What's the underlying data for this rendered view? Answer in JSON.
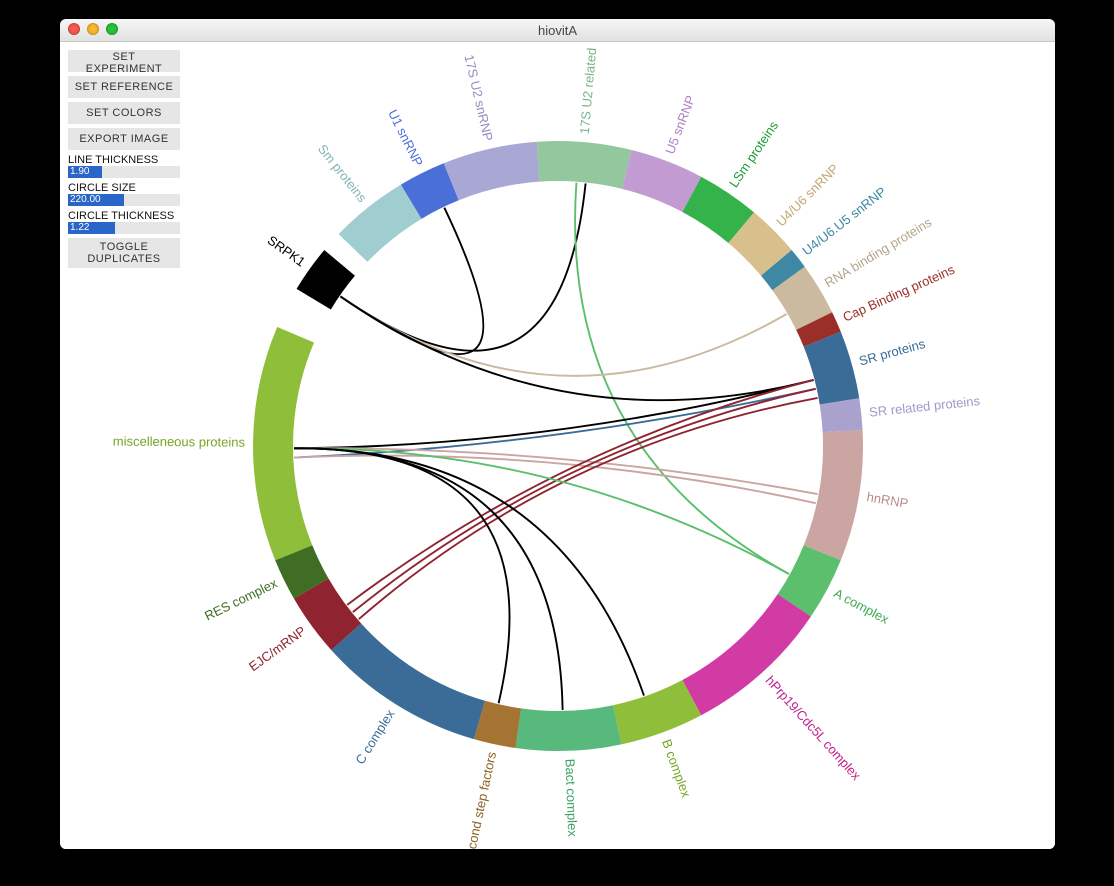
{
  "window": {
    "title": "hiovitA"
  },
  "sidebar": {
    "set_experiment": "SET EXPERIMENT",
    "set_reference": "SET REFERENCE",
    "set_colors": "SET COLORS",
    "export_image": "EXPORT IMAGE",
    "line_thickness_label": "LINE THICKNESS",
    "line_thickness_value": "1.90",
    "circle_size_label": "CIRCLE SIZE",
    "circle_size_value": "220.00",
    "circle_thickness_label": "CIRCLE THICKNESS",
    "circle_thickness_value": "1.22",
    "toggle_duplicates": "TOGGLE\nDUPLICATES"
  },
  "slider_fill": {
    "line_thickness": 0.3,
    "circle_size": 0.5,
    "circle_thickness": 0.42
  },
  "ring": {
    "radius": 305,
    "thickness": 40,
    "segments": [
      {
        "name": "Sm proteins",
        "start": 121,
        "span": 15,
        "color": "#9fcdd0",
        "labelColor": "#83b3b6"
      },
      {
        "name": "U1 snRNP",
        "start": 112,
        "span": 9,
        "color": "#4a6fd6",
        "labelColor": "#4a6fd6"
      },
      {
        "name": "17S U2 snRNP",
        "start": 94,
        "span": 18,
        "color": "#a9a8d5",
        "labelColor": "#908ec2"
      },
      {
        "name": "17S U2 related",
        "start": 76,
        "span": 18,
        "color": "#93c79e",
        "labelColor": "#7ab589"
      },
      {
        "name": "U5 snRNP",
        "start": 62,
        "span": 14,
        "color": "#c39bd3",
        "labelColor": "#b07ec6"
      },
      {
        "name": "LSm proteins",
        "start": 50,
        "span": 12,
        "color": "#34b34a",
        "labelColor": "#1d9e34"
      },
      {
        "name": "U4/U6 snRNP",
        "start": 40,
        "span": 10,
        "color": "#d7c08c",
        "labelColor": "#c0a971"
      },
      {
        "name": "U4/U6.U5 snRNP",
        "start": 36,
        "span": 4,
        "color": "#3f88a3",
        "labelColor": "#3f88a3"
      },
      {
        "name": "RNA binding proteins",
        "start": 26,
        "span": 10,
        "color": "#cbb9a0",
        "labelColor": "#b6a48b"
      },
      {
        "name": "Cap Binding proteins",
        "start": 22,
        "span": 4,
        "color": "#9a2f2a",
        "labelColor": "#9a2f2a"
      },
      {
        "name": "SR proteins",
        "start": 9,
        "span": 13,
        "color": "#3a6c97",
        "labelColor": "#3a6c97"
      },
      {
        "name": "SR related proteins",
        "start": 3,
        "span": 6,
        "color": "#a9a2cf",
        "labelColor": "#a199c9"
      },
      {
        "name": "hnRNP",
        "start": 338,
        "span": 25,
        "color": "#cba5a1",
        "labelColor": "#b98c87"
      },
      {
        "name": "A complex",
        "start": 326,
        "span": 12,
        "color": "#5bbf6d",
        "labelColor": "#3ea952"
      },
      {
        "name": "hPrp19/Cdc5L complex",
        "start": 298,
        "span": 28,
        "color": "#d23aa4",
        "labelColor": "#c0208d"
      },
      {
        "name": "B complex",
        "start": 282,
        "span": 16,
        "color": "#8fbf3a",
        "labelColor": "#77a525"
      },
      {
        "name": "Bact complex",
        "start": 262,
        "span": 20,
        "color": "#58b97c",
        "labelColor": "#3ca164"
      },
      {
        "name": "Second step factors",
        "start": 254,
        "span": 8,
        "color": "#a57432",
        "labelColor": "#8b5f23"
      },
      {
        "name": "C complex",
        "start": 222,
        "span": 32,
        "color": "#3a6c97",
        "labelColor": "#3a6c97"
      },
      {
        "name": "EJC/mRNP",
        "start": 210,
        "span": 12,
        "color": "#8f2430",
        "labelColor": "#8f2430"
      },
      {
        "name": "RES complex",
        "start": 202,
        "span": 8,
        "color": "#3e6d23",
        "labelColor": "#3e6d23"
      },
      {
        "name": "miscelleneous proteins",
        "start": 157,
        "span": 45,
        "color": "#8fbf3a",
        "labelColor": "#77a525"
      },
      {
        "name": "gap-white",
        "start": 149,
        "span": 8,
        "color": "#ffffff",
        "labelColor": "#ffffff",
        "noLabel": true
      },
      {
        "name": "SRPK1",
        "start": 140,
        "span": 9,
        "color": "#000000",
        "labelColor": "#000000"
      },
      {
        "name": "gap-white-2",
        "start": 136,
        "span": 4,
        "color": "#ffffff",
        "labelColor": "#ffffff",
        "noLabel": true
      }
    ]
  },
  "links": [
    {
      "from": "SRPK1",
      "to": "U1 snRNP",
      "color": "#000000"
    },
    {
      "from": "SRPK1",
      "to": "17S U2 related",
      "color": "#000000"
    },
    {
      "from": "17S U2 related",
      "to": "A complex",
      "color": "#5bbf6d"
    },
    {
      "from": "SRPK1",
      "to": "RNA binding proteins",
      "color": "#cbb9a0"
    },
    {
      "from": "SRPK1",
      "to": "SR proteins",
      "color": "#000000"
    },
    {
      "from": "miscelleneous proteins",
      "to": "SR proteins",
      "color": "#000000"
    },
    {
      "from": "miscelleneous proteins",
      "to": "SR proteins",
      "color": "#3a6c97"
    },
    {
      "from": "miscelleneous proteins",
      "to": "hnRNP",
      "color": "#cba5a1"
    },
    {
      "from": "miscelleneous proteins",
      "to": "hnRNP",
      "color": "#cba5a1"
    },
    {
      "from": "EJC/mRNP",
      "to": "SR proteins",
      "color": "#8f2430"
    },
    {
      "from": "EJC/mRNP",
      "to": "SR proteins",
      "color": "#8f2430"
    },
    {
      "from": "EJC/mRNP",
      "to": "SR proteins",
      "color": "#8f2430"
    },
    {
      "from": "miscelleneous proteins",
      "to": "A complex",
      "color": "#5bbf6d"
    },
    {
      "from": "miscelleneous proteins",
      "to": "B complex",
      "color": "#000000"
    },
    {
      "from": "miscelleneous proteins",
      "to": "Bact complex",
      "color": "#000000"
    },
    {
      "from": "miscelleneous proteins",
      "to": "Second step factors",
      "color": "#000000"
    }
  ],
  "colors": {
    "window_bg": "#ffffff"
  }
}
